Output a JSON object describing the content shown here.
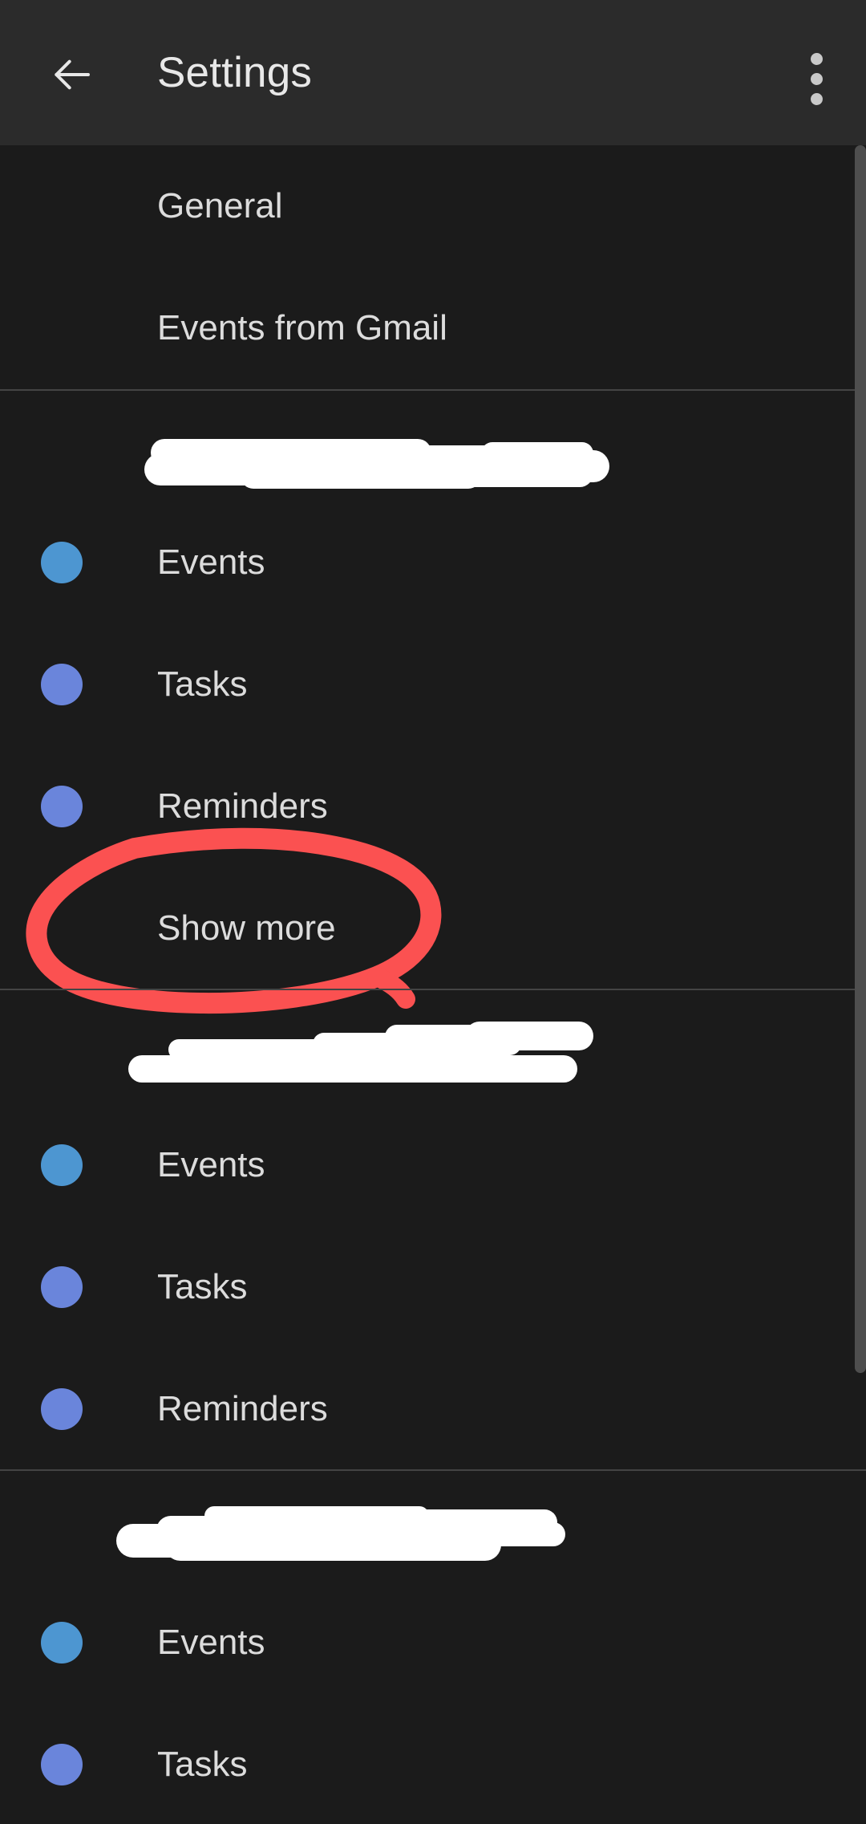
{
  "appbar": {
    "title": "Settings",
    "back_icon": "arrow-left-icon",
    "overflow_icon": "more-vertical-icon"
  },
  "colors": {
    "appbar_bg": "#2b2b2b",
    "page_bg": "#1b1b1b",
    "divider": "#444444",
    "primary_text": "#dcdcdc",
    "title_text": "#e8e8e8",
    "events_dot": "#4d96d1",
    "tasks_dot": "#6a85db",
    "reminders_dot": "#6a85db",
    "annotation_red": "#fb5151",
    "redaction_white": "#ffffff",
    "scrollbar_thumb": "#4e4e4e"
  },
  "sections": [
    {
      "id": "general-section",
      "header": null,
      "rows": [
        {
          "label": "General",
          "dot": null
        },
        {
          "label": "Events from Gmail",
          "dot": null
        }
      ]
    },
    {
      "id": "account-section-1",
      "header": {
        "redacted": true,
        "label": ""
      },
      "rows": [
        {
          "label": "Events",
          "dot": "#4d96d1"
        },
        {
          "label": "Tasks",
          "dot": "#6a85db"
        },
        {
          "label": "Reminders",
          "dot": "#6a85db"
        },
        {
          "label": "Show more",
          "dot": null,
          "annotated": true
        }
      ]
    },
    {
      "id": "account-section-2",
      "header": {
        "redacted": true,
        "label": ""
      },
      "rows": [
        {
          "label": "Events",
          "dot": "#4d96d1"
        },
        {
          "label": "Tasks",
          "dot": "#6a85db"
        },
        {
          "label": "Reminders",
          "dot": "#6a85db"
        }
      ]
    },
    {
      "id": "account-section-3",
      "header": {
        "redacted": true,
        "label": ""
      },
      "rows": [
        {
          "label": "Events",
          "dot": "#4d96d1"
        },
        {
          "label": "Tasks",
          "dot": "#6a85db"
        }
      ]
    }
  ],
  "annotation": {
    "type": "hand-drawn-ellipse",
    "target": "Show more",
    "color": "#fb5151"
  },
  "scrollbar": {
    "visible": true,
    "thumb_top": 0,
    "thumb_height": 1530
  }
}
